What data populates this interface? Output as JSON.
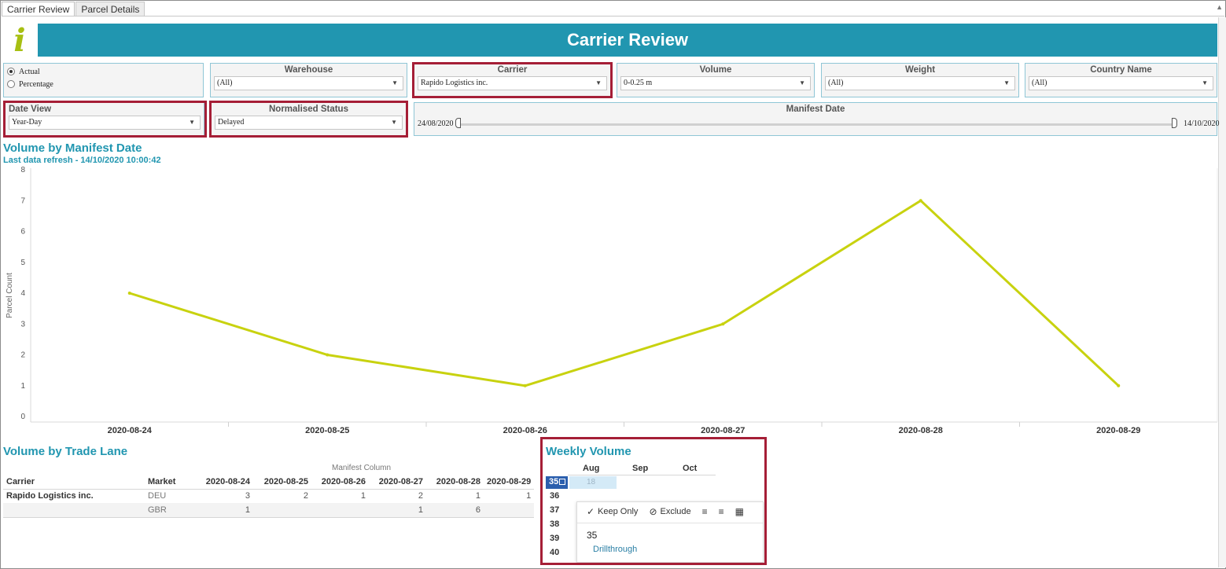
{
  "tabs": [
    {
      "label": "Carrier Review",
      "active": true
    },
    {
      "label": "Parcel Details",
      "active": false
    }
  ],
  "header": {
    "title": "Carrier Review",
    "logo_letter": "i"
  },
  "colors": {
    "accent": "#2196b0",
    "line": "#c8d20f",
    "highlight": "#a51e36",
    "logo": "#a7bf12"
  },
  "filters": {
    "measure": {
      "options": [
        "Actual",
        "Percentage"
      ],
      "selected": "Actual"
    },
    "warehouse": {
      "title": "Warehouse",
      "value": "(All)"
    },
    "carrier": {
      "title": "Carrier",
      "value": "Rapido Logistics inc."
    },
    "volume": {
      "title": "Volume",
      "value": "0-0.25 m"
    },
    "weight": {
      "title": "Weight",
      "value": "(All)"
    },
    "country": {
      "title": "Country Name",
      "value": "(All)"
    },
    "date_view": {
      "title": "Date View",
      "value": "Year-Day"
    },
    "normalised_status": {
      "title": "Normalised Status",
      "value": "Delayed"
    },
    "manifest_date": {
      "title": "Manifest Date",
      "start": "24/08/2020",
      "end": "14/10/2020"
    }
  },
  "volume_chart": {
    "title": "Volume by Manifest Date",
    "subtitle": "Last data refresh - 14/10/2020 10:00:42"
  },
  "chart_data": {
    "type": "line",
    "categories": [
      "2020-08-24",
      "2020-08-25",
      "2020-08-26",
      "2020-08-27",
      "2020-08-28",
      "2020-08-29"
    ],
    "values": [
      4,
      2,
      1,
      3,
      7,
      1
    ],
    "ylabel": "Parcel Count",
    "xlabel": "",
    "ylim": [
      0,
      8
    ],
    "yticks": [
      "0",
      "1",
      "2",
      "3",
      "4",
      "5",
      "6",
      "7",
      "8"
    ],
    "grid": false
  },
  "trade_lane": {
    "title": "Volume by Trade Lane",
    "column_group": "Manifest Column",
    "headers": {
      "carrier": "Carrier",
      "market": "Market"
    },
    "dates": [
      "2020-08-24",
      "2020-08-25",
      "2020-08-26",
      "2020-08-27",
      "2020-08-28",
      "2020-08-29"
    ],
    "rows": [
      {
        "carrier": "Rapido Logistics inc.",
        "market": "DEU",
        "values": [
          "3",
          "2",
          "1",
          "2",
          "1",
          "1"
        ]
      },
      {
        "carrier": "",
        "market": "GBR",
        "values": [
          "1",
          "",
          "",
          "1",
          "6",
          ""
        ]
      }
    ]
  },
  "weekly": {
    "title": "Weekly Volume",
    "months": [
      "Aug",
      "Sep",
      "Oct"
    ],
    "weeks": [
      "35",
      "36",
      "37",
      "38",
      "39",
      "40"
    ],
    "selected_week": "35",
    "selected_value": "18"
  },
  "tooltip": {
    "keep_only": "Keep Only",
    "exclude": "Exclude",
    "value": "35",
    "drillthrough": "Drillthrough"
  }
}
